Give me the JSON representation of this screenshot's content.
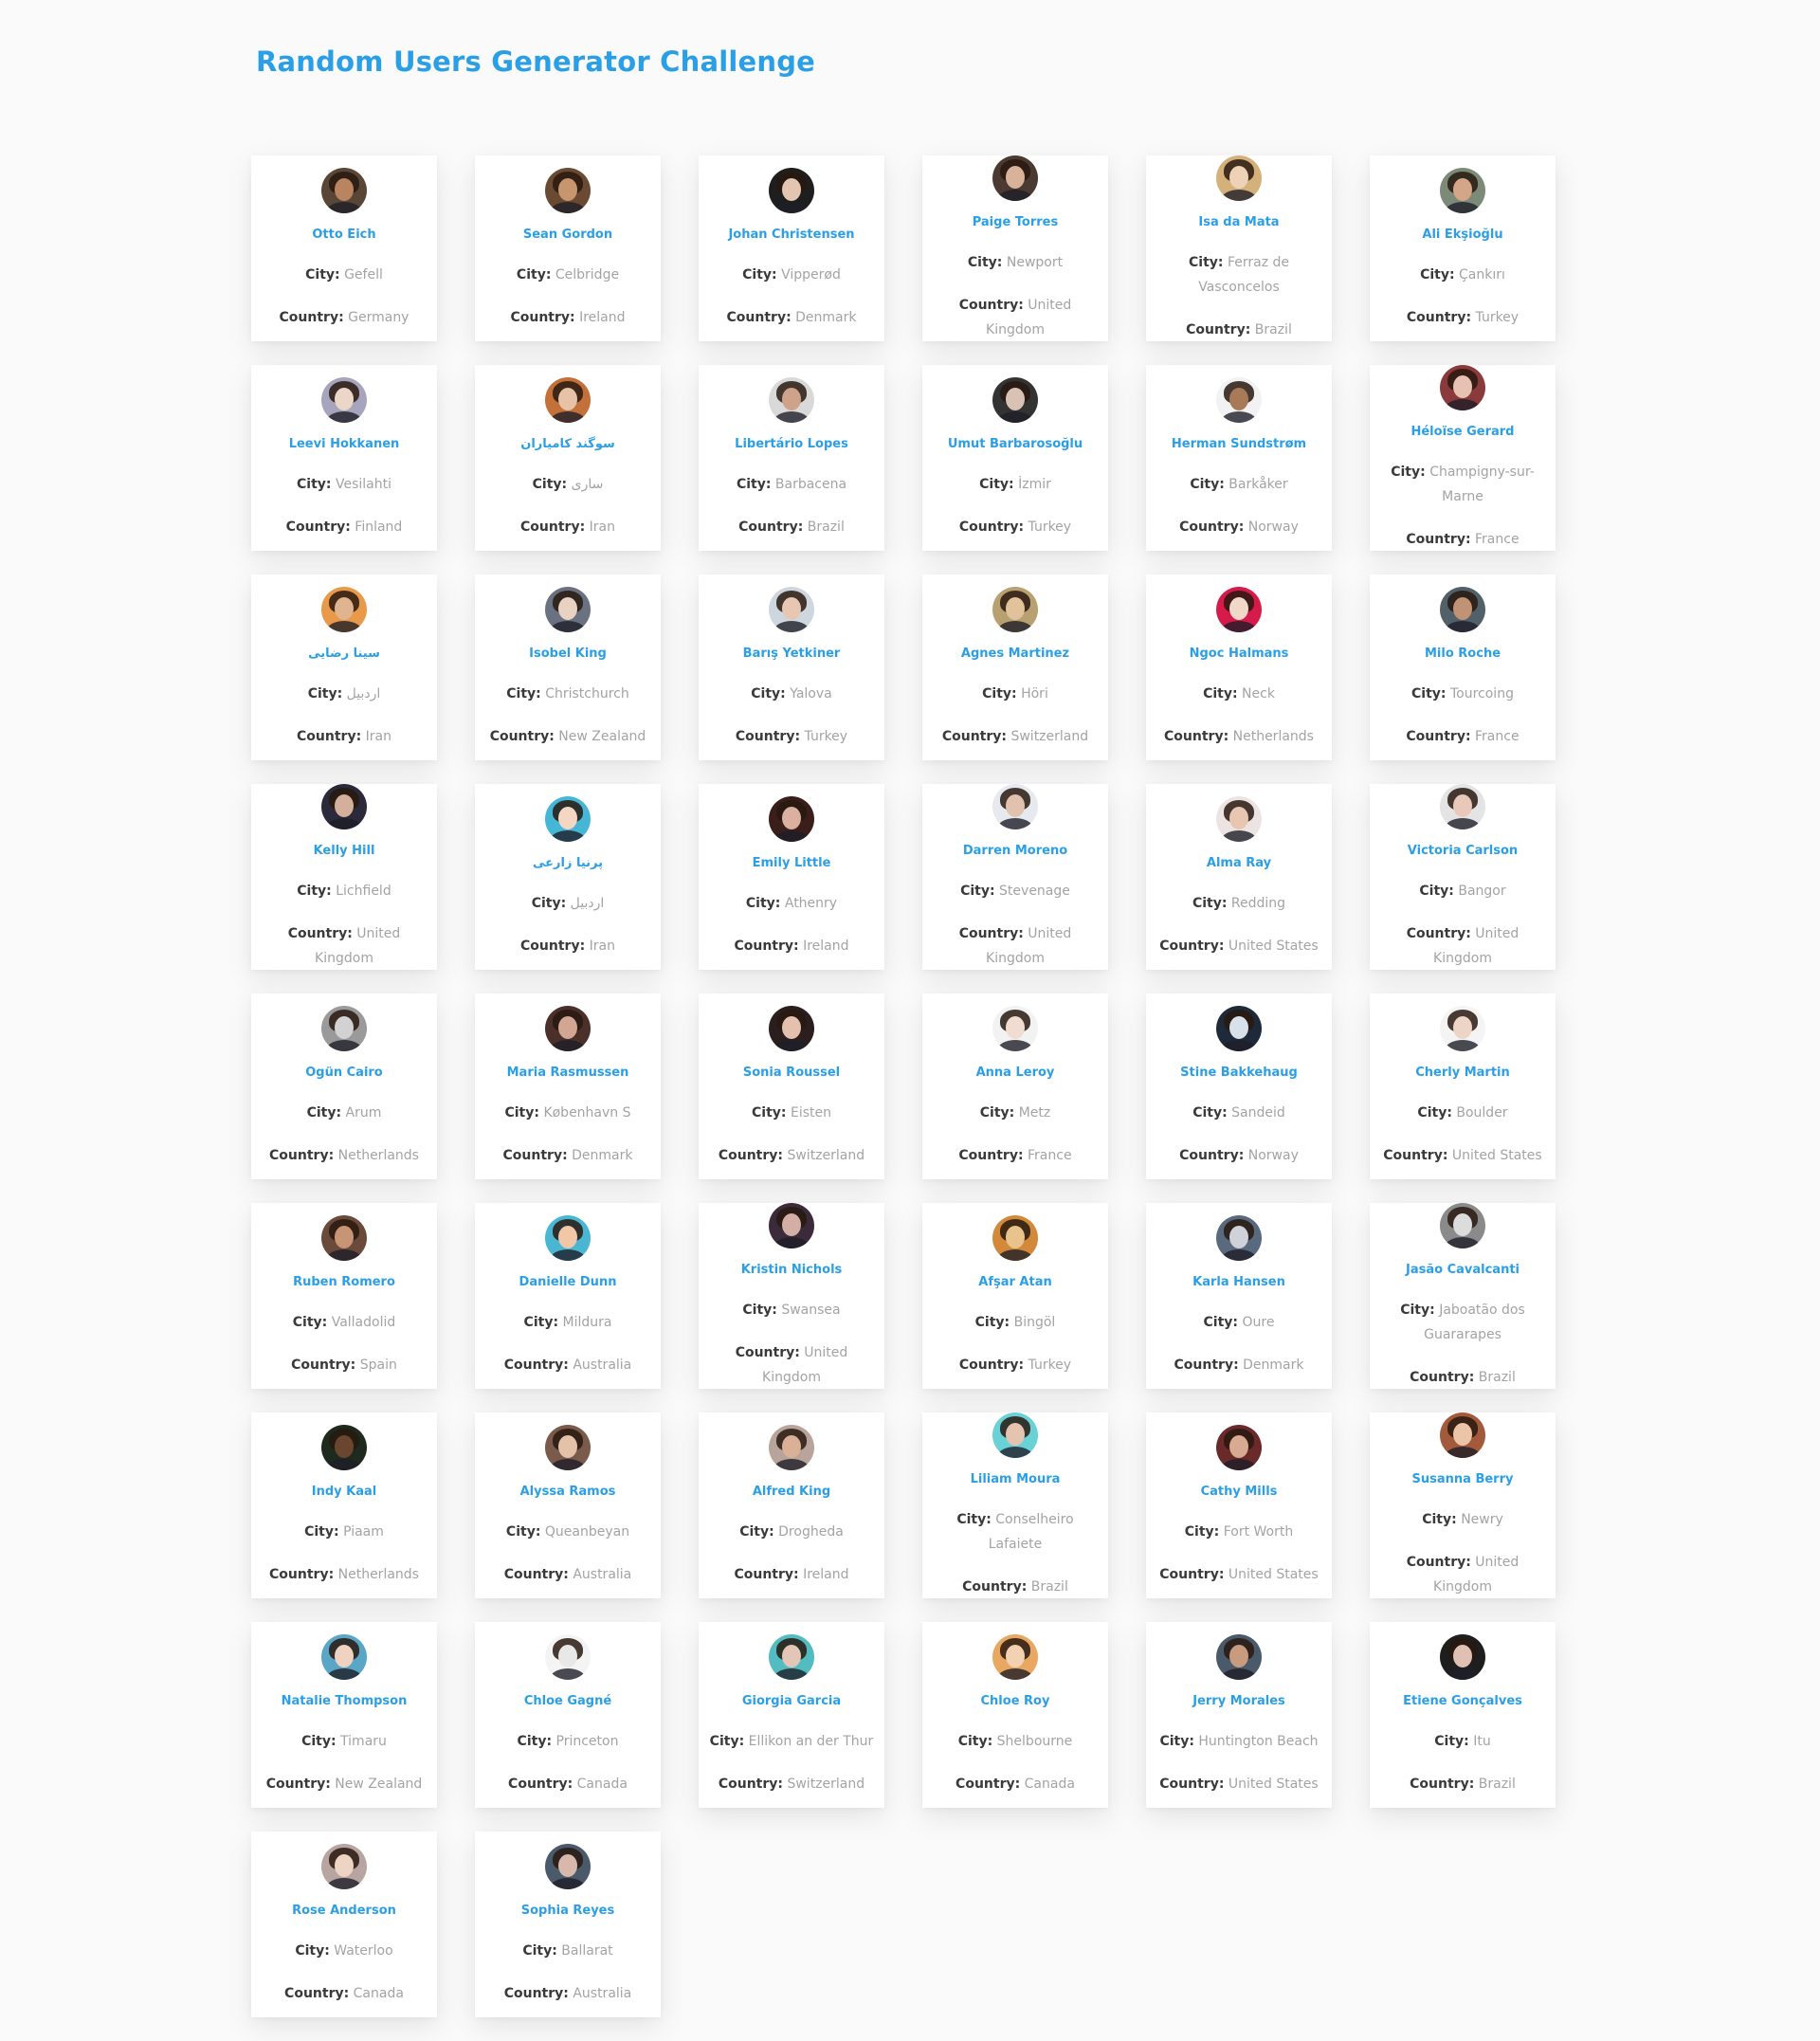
{
  "page": {
    "title": "Random Users Generator Challenge"
  },
  "labels": {
    "city": "City:",
    "country": "Country:"
  },
  "users": [
    {
      "name": "Otto Eich",
      "city": "Gefell",
      "country": "Germany",
      "skin": "#b98560",
      "bg": "#5a4636"
    },
    {
      "name": "Sean Gordon",
      "city": "Celbridge",
      "country": "Ireland",
      "skin": "#c8966e",
      "bg": "#6a4a32"
    },
    {
      "name": "Johan Christensen",
      "city": "Vipperød",
      "country": "Denmark",
      "skin": "#e2c6b0",
      "bg": "#1e1e1e"
    },
    {
      "name": "Paige Torres",
      "city": "Newport",
      "country": "United Kingdom",
      "skin": "#d9b29a",
      "bg": "#4a3a32"
    },
    {
      "name": "Isa da Mata",
      "city": "Ferraz de Vasconcelos",
      "country": "Brazil",
      "skin": "#edd2b8",
      "bg": "#d4b07a"
    },
    {
      "name": "Ali Ekşioğlu",
      "city": "Çankırı",
      "country": "Turkey",
      "skin": "#d3a68a",
      "bg": "#7c8a78"
    },
    {
      "name": "Leevi Hokkanen",
      "city": "Vesilahti",
      "country": "Finland",
      "skin": "#ecd6c8",
      "bg": "#a7a5bd"
    },
    {
      "name": "سوگند کامیاران",
      "city": "ساری",
      "country": "Iran",
      "skin": "#e6c2a6",
      "bg": "#c4703a"
    },
    {
      "name": "Libertário Lopes",
      "city": "Barbacena",
      "country": "Brazil",
      "skin": "#cfa38a",
      "bg": "#d9d9d9"
    },
    {
      "name": "Umut Barbarosoğlu",
      "city": "İzmir",
      "country": "Turkey",
      "skin": "#d9c2b3",
      "bg": "#333333"
    },
    {
      "name": "Herman Sundstrøm",
      "city": "Barkåker",
      "country": "Norway",
      "skin": "#a87a58",
      "bg": "#f2f2f2"
    },
    {
      "name": "Héloïse Gerard",
      "city": "Champigny-sur-Marne",
      "country": "France",
      "skin": "#e6c2b2",
      "bg": "#8a3a3a"
    },
    {
      "name": "سینا رضایی",
      "city": "اردبیل",
      "country": "Iran",
      "skin": "#e0b48e",
      "bg": "#e89a4a"
    },
    {
      "name": "Isobel King",
      "city": "Christchurch",
      "country": "New Zealand",
      "skin": "#ead2c2",
      "bg": "#6a7282"
    },
    {
      "name": "Barış Yetkiner",
      "city": "Yalova",
      "country": "Turkey",
      "skin": "#e8c7b2",
      "bg": "#ced6de"
    },
    {
      "name": "Agnes Martinez",
      "city": "Höri",
      "country": "Switzerland",
      "skin": "#e2c29a",
      "bg": "#b8a070"
    },
    {
      "name": "Ngoc Halmans",
      "city": "Neck",
      "country": "Netherlands",
      "skin": "#f0d8c8",
      "bg": "#d61a4a"
    },
    {
      "name": "Milo Roche",
      "city": "Tourcoing",
      "country": "France",
      "skin": "#c09276",
      "bg": "#52606a"
    },
    {
      "name": "Kelly Hill",
      "city": "Lichfield",
      "country": "United Kingdom",
      "skin": "#d4b09a",
      "bg": "#2a2a3a"
    },
    {
      "name": "پرنیا زارعی",
      "city": "اردبیل",
      "country": "Iran",
      "skin": "#f4d6c2",
      "bg": "#46b6d6"
    },
    {
      "name": "Emily Little",
      "city": "Athenry",
      "country": "Ireland",
      "skin": "#dcb0a0",
      "bg": "#3a1e1a"
    },
    {
      "name": "Darren Moreno",
      "city": "Stevenage",
      "country": "United Kingdom",
      "skin": "#e0c2ae",
      "bg": "#e6eaee"
    },
    {
      "name": "Alma Ray",
      "city": "Redding",
      "country": "United States",
      "skin": "#e8c6b0",
      "bg": "#ece4e2"
    },
    {
      "name": "Victoria Carlson",
      "city": "Bangor",
      "country": "United Kingdom",
      "skin": "#e8c8b8",
      "bg": "#e4e4e4"
    },
    {
      "name": "Ogün Cairo",
      "city": "Arum",
      "country": "Netherlands",
      "skin": "#d2d2d2",
      "bg": "#9a9a9a"
    },
    {
      "name": "Maria Rasmussen",
      "city": "København S",
      "country": "Denmark",
      "skin": "#d2a692",
      "bg": "#4a3028"
    },
    {
      "name": "Sonia Roussel",
      "city": "Eisten",
      "country": "Switzerland",
      "skin": "#e4c0ae",
      "bg": "#2a1e1e"
    },
    {
      "name": "Anna Leroy",
      "city": "Metz",
      "country": "France",
      "skin": "#f0dcd0",
      "bg": "#f2f2f2"
    },
    {
      "name": "Stine Bakkehaug",
      "city": "Sandeid",
      "country": "Norway",
      "skin": "#d8e0ea",
      "bg": "#1e2a3a"
    },
    {
      "name": "Cherly Martin",
      "city": "Boulder",
      "country": "United States",
      "skin": "#ecd4c6",
      "bg": "#f4f4f4"
    },
    {
      "name": "Ruben Romero",
      "city": "Valladolid",
      "country": "Spain",
      "skin": "#c89476",
      "bg": "#6a4a3a"
    },
    {
      "name": "Danielle Dunn",
      "city": "Mildura",
      "country": "Australia",
      "skin": "#f0c8a8",
      "bg": "#4ab6d2"
    },
    {
      "name": "Kristin Nichols",
      "city": "Swansea",
      "country": "United Kingdom",
      "skin": "#d2aea4",
      "bg": "#3a2a3a"
    },
    {
      "name": "Afşar Atan",
      "city": "Bingöl",
      "country": "Turkey",
      "skin": "#e8c48c",
      "bg": "#d28a3a"
    },
    {
      "name": "Karla Hansen",
      "city": "Oure",
      "country": "Denmark",
      "skin": "#cfd2d8",
      "bg": "#5a6a7e"
    },
    {
      "name": "Jasão Cavalcanti",
      "city": "Jaboatão dos Guararapes",
      "country": "Brazil",
      "skin": "#dcdcdc",
      "bg": "#8a8a8a"
    },
    {
      "name": "Indy Kaal",
      "city": "Piaam",
      "country": "Netherlands",
      "skin": "#6a4630",
      "bg": "#1e2a1e"
    },
    {
      "name": "Alyssa Ramos",
      "city": "Queanbeyan",
      "country": "Australia",
      "skin": "#e4c2aa",
      "bg": "#7a5a4a"
    },
    {
      "name": "Alfred King",
      "city": "Drogheda",
      "country": "Ireland",
      "skin": "#dab096",
      "bg": "#b8a49a"
    },
    {
      "name": "Liliam Moura",
      "city": "Conselheiro Lafaiete",
      "country": "Brazil",
      "skin": "#e4c4b0",
      "bg": "#6ad2d6"
    },
    {
      "name": "Cathy Mills",
      "city": "Fort Worth",
      "country": "United States",
      "skin": "#d8aa92",
      "bg": "#6a2a2a"
    },
    {
      "name": "Susanna Berry",
      "city": "Newry",
      "country": "United Kingdom",
      "skin": "#ecc4a8",
      "bg": "#a25a3a"
    },
    {
      "name": "Natalie Thompson",
      "city": "Timaru",
      "country": "New Zealand",
      "skin": "#f0d2c0",
      "bg": "#5aa6c6"
    },
    {
      "name": "Chloe Gagné",
      "city": "Princeton",
      "country": "Canada",
      "skin": "#e8e8e8",
      "bg": "#f4f4f4"
    },
    {
      "name": "Giorgia Garcia",
      "city": "Ellikon an der Thur",
      "country": "Switzerland",
      "skin": "#e4c6b6",
      "bg": "#52bcc0"
    },
    {
      "name": "Chloe Roy",
      "city": "Shelbourne",
      "country": "Canada",
      "skin": "#f2d2b2",
      "bg": "#e8a862"
    },
    {
      "name": "Jerry Morales",
      "city": "Huntington Beach",
      "country": "United States",
      "skin": "#c89a7e",
      "bg": "#4a5a6a"
    },
    {
      "name": "Etiene Gonçalves",
      "city": "Itu",
      "country": "Brazil",
      "skin": "#e0c0b2",
      "bg": "#1e1e1e"
    },
    {
      "name": "Rose Anderson",
      "city": "Waterloo",
      "country": "Canada",
      "skin": "#eed4c2",
      "bg": "#b8a4a0"
    },
    {
      "name": "Sophia Reyes",
      "city": "Ballarat",
      "country": "Australia",
      "skin": "#d8b8aa",
      "bg": "#4a5a6a"
    }
  ]
}
